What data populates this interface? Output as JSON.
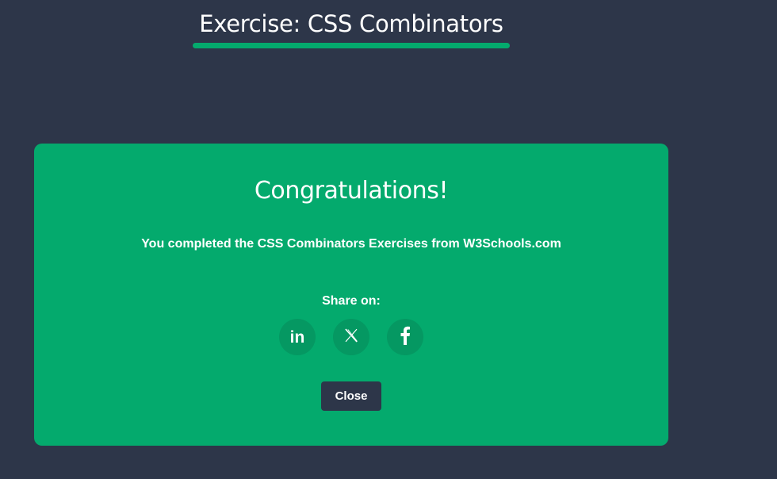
{
  "header": {
    "title": "Exercise: CSS Combinators"
  },
  "modal": {
    "heading": "Congratulations!",
    "message": "You completed the CSS Combinators Exercises from W3Schools.com",
    "share_label": "Share on:",
    "share_buttons": [
      {
        "network": "LinkedIn",
        "icon": "linkedin-icon",
        "glyph": "in"
      },
      {
        "network": "X",
        "icon": "x-logo-icon",
        "glyph": "𝕏"
      },
      {
        "network": "Facebook",
        "icon": "facebook-icon",
        "glyph": "f"
      }
    ],
    "close_label": "Close"
  },
  "colors": {
    "background": "#2d3649",
    "accent": "#04aa6d",
    "share_button_bg": "#059862",
    "text": "#ffffff"
  }
}
